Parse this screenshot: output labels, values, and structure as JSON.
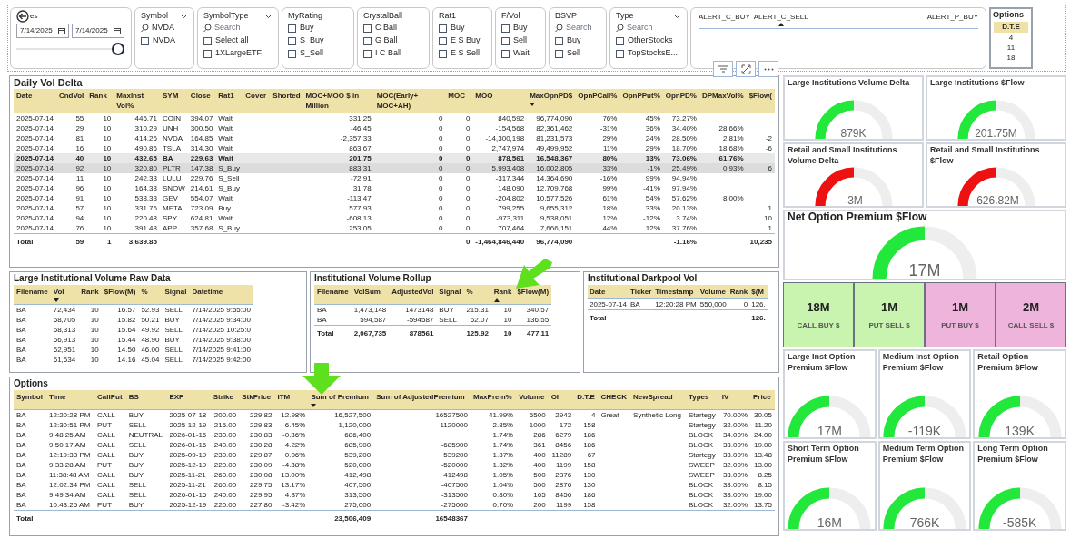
{
  "date_slicer": {
    "title": "es",
    "start": "7/14/2025",
    "end": "7/14/2025",
    "level": 1
  },
  "slicers": [
    {
      "title": "Symbol",
      "dropdown": true,
      "search_value": "NVDA",
      "items": [
        {
          "label": "NVDA",
          "checked": false
        }
      ]
    },
    {
      "title": "SymbolType",
      "dropdown": true,
      "search_placeholder": "Search",
      "items": [
        {
          "label": "Select all",
          "checked": false
        },
        {
          "label": "1XLargeETF",
          "checked": false
        }
      ]
    },
    {
      "title": "MyRating",
      "dropdown": false,
      "items": [
        {
          "label": "Buy",
          "checked": false
        },
        {
          "label": "S_Buy",
          "checked": false
        },
        {
          "label": "S_Sell",
          "checked": false
        }
      ]
    },
    {
      "title": "CrystalBall",
      "dropdown": false,
      "items": [
        {
          "label": "C Ball",
          "checked": false
        },
        {
          "label": "G Ball",
          "checked": false
        },
        {
          "label": "I C Ball",
          "checked": false
        }
      ]
    },
    {
      "title": "Rat1",
      "dropdown": false,
      "items": [
        {
          "label": "Buy",
          "checked": false
        },
        {
          "label": "E S Buy",
          "checked": false
        },
        {
          "label": "E S Sell",
          "checked": false
        }
      ]
    },
    {
      "title": "F/Vol",
      "dropdown": false,
      "items": [
        {
          "label": "Buy",
          "checked": false
        },
        {
          "label": "Sell",
          "checked": false
        },
        {
          "label": "Wait",
          "checked": false
        }
      ]
    },
    {
      "title": "BSVP",
      "dropdown": false,
      "search_placeholder": "Search",
      "items": [
        {
          "label": "Buy",
          "checked": false
        },
        {
          "label": "Sell",
          "checked": false
        }
      ]
    },
    {
      "title": "Type",
      "dropdown": true,
      "search_placeholder": "Search",
      "items": [
        {
          "label": "OtherStocks",
          "checked": false
        },
        {
          "label": "TopStocksE...",
          "checked": false
        }
      ]
    }
  ],
  "alerts": [
    {
      "label": "ALERT_C_BUY",
      "sorted": false
    },
    {
      "label": "ALERT_C_SELL",
      "sorted": true
    },
    {
      "label": "ALERT_P_BUY",
      "sorted": false
    }
  ],
  "options_slicer": {
    "title": "Options",
    "header": "D.T.E",
    "values": [
      "4",
      "11",
      "18"
    ]
  },
  "daily_vol_delta": {
    "title": "Daily Vol Delta",
    "sort_ascending": false,
    "columns": [
      {
        "label": "Date",
        "sorted": false
      },
      {
        "label": "CndVol",
        "sorted": false
      },
      {
        "label": "Rank",
        "sorted": false
      },
      {
        "label": "MaxInst Vol%",
        "sorted": false
      },
      {
        "label": "SYM",
        "sorted": false
      },
      {
        "label": "Close",
        "sorted": false
      },
      {
        "label": "Rat1",
        "sorted": false
      },
      {
        "label": "Cover",
        "sorted": false
      },
      {
        "label": "Shorted",
        "sorted": false
      },
      {
        "label": "MOC+MOO $ in Million",
        "sorted": false
      },
      {
        "label": "MOC(Early+ MOC+AH)",
        "sorted": false
      },
      {
        "label": "MOC",
        "sorted": false
      },
      {
        "label": "MOO",
        "sorted": false
      },
      {
        "label": "MaxOpnPD$",
        "sorted": true
      },
      {
        "label": "OpnPCall%",
        "sorted": false
      },
      {
        "label": "OpnPPut%",
        "sorted": false
      },
      {
        "label": "OpnPD%",
        "sorted": false
      },
      {
        "label": "DPMaxVol%",
        "sorted": false
      },
      {
        "label": "$Flow(",
        "sorted": false
      }
    ],
    "rows": [
      {
        "date": "2025-07-14",
        "cnd_vol": "55",
        "rank": "10",
        "max_inst": "446.71",
        "sym": "COIN",
        "close": "394.07",
        "rat1": "Wait",
        "moc_moo": "331.25",
        "moc_early": "0",
        "moc": "0",
        "moo": "840,592",
        "max_opn": "96,774,090",
        "call": "76%",
        "put": "45%",
        "opn_pd": "73.27%",
        "selected": false,
        "hovered": false
      },
      {
        "date": "2025-07-14",
        "cnd_vol": "29",
        "rank": "10",
        "max_inst": "310.29",
        "sym": "UNH",
        "close": "300.50",
        "rat1": "Wait",
        "moc_moo": "-46.45",
        "moc_early": "0",
        "moc": "0",
        "moo": "-154,568",
        "max_opn": "82,361,462",
        "call": "-31%",
        "put": "36%",
        "opn_pd": "34.40%",
        "dp_max": "28.66%",
        "selected": false,
        "hovered": false
      },
      {
        "date": "2025-07-14",
        "cnd_vol": "81",
        "rank": "10",
        "max_inst": "414.26",
        "sym": "NVDA",
        "close": "164.85",
        "rat1": "Wait",
        "moc_moo": "-2,357.33",
        "moc_early": "0",
        "moc": "0",
        "moo": "-14,300,198",
        "max_opn": "81,231,573",
        "call": "29%",
        "put": "24%",
        "opn_pd": "28.50%",
        "dp_max": "2.81%",
        "column_19": "-2",
        "selected": false,
        "hovered": false
      },
      {
        "date": "2025-07-14",
        "cnd_vol": "16",
        "rank": "10",
        "max_inst": "490.86",
        "sym": "TSLA",
        "close": "314.30",
        "rat1": "Wait",
        "moc_moo": "863.67",
        "moc_early": "0",
        "moc": "0",
        "moo": "2,747,974",
        "max_opn": "49,499,952",
        "call": "11%",
        "put": "29%",
        "opn_pd": "18.70%",
        "dp_max": "18.68%",
        "column_19": "-6",
        "selected": false,
        "hovered": false
      },
      {
        "date": "2025-07-14",
        "cnd_vol": "40",
        "rank": "10",
        "max_inst": "432.65",
        "sym": "BA",
        "close": "229.63",
        "rat1": "Wait",
        "moc_moo": "201.75",
        "moc_early": "0",
        "moc": "0",
        "moo": "878,561",
        "max_opn": "16,548,367",
        "call": "80%",
        "put": "13%",
        "opn_pd": "73.06%",
        "dp_max": "61.76%",
        "selected": true,
        "hovered": false
      },
      {
        "date": "2025-07-14",
        "cnd_vol": "92",
        "rank": "10",
        "max_inst": "320.80",
        "sym": "PLTR",
        "close": "147.38",
        "rat1": "S_Buy",
        "moc_moo": "883.31",
        "moc_early": "0",
        "moc": "0",
        "moo": "5,993,408",
        "max_opn": "16,002,805",
        "call": "33%",
        "put": "-1%",
        "opn_pd": "25.49%",
        "dp_max": "0.93%",
        "column_19": "6",
        "selected": false,
        "hovered": true
      },
      {
        "date": "2025-07-14",
        "cnd_vol": "11",
        "rank": "10",
        "max_inst": "242.33",
        "sym": "LULU",
        "close": "229.76",
        "rat1": "S_Sell",
        "moc_moo": "-72.91",
        "moc_early": "0",
        "moc": "0",
        "moo": "-317,344",
        "max_opn": "14,364,690",
        "call": "-16%",
        "put": "99%",
        "opn_pd": "94.94%",
        "selected": false,
        "hovered": false
      },
      {
        "date": "2025-07-14",
        "cnd_vol": "96",
        "rank": "10",
        "max_inst": "164.38",
        "sym": "SNOW",
        "close": "214.61",
        "rat1": "S_Buy",
        "moc_moo": "31.78",
        "moc_early": "0",
        "moc": "0",
        "moo": "148,090",
        "max_opn": "12,709,768",
        "call": "99%",
        "put": "-41%",
        "opn_pd": "97.94%",
        "selected": false,
        "hovered": false
      },
      {
        "date": "2025-07-14",
        "cnd_vol": "91",
        "rank": "10",
        "max_inst": "538.33",
        "sym": "GEV",
        "close": "554.07",
        "rat1": "Wait",
        "moc_moo": "-113.47",
        "moc_early": "0",
        "moc": "0",
        "moo": "-204,802",
        "max_opn": "10,577,526",
        "call": "61%",
        "put": "54%",
        "opn_pd": "57.62%",
        "dp_max": "8.00%",
        "selected": false,
        "hovered": false
      },
      {
        "date": "2025-07-14",
        "cnd_vol": "57",
        "rank": "10",
        "max_inst": "331.76",
        "sym": "META",
        "close": "723.09",
        "rat1": "Buy",
        "moc_moo": "577.93",
        "moc_early": "0",
        "moc": "0",
        "moo": "799,255",
        "max_opn": "9,655,312",
        "call": "18%",
        "put": "33%",
        "opn_pd": "20.13%",
        "column_19": "1",
        "selected": false,
        "hovered": false
      },
      {
        "date": "2025-07-14",
        "cnd_vol": "94",
        "rank": "10",
        "max_inst": "220.48",
        "sym": "SPY",
        "close": "624.81",
        "rat1": "Wait",
        "moc_moo": "-608.13",
        "moc_early": "0",
        "moc": "0",
        "moo": "-973,311",
        "max_opn": "9,538,051",
        "call": "12%",
        "put": "-12%",
        "opn_pd": "3.74%",
        "column_19": "10",
        "selected": false,
        "hovered": false
      },
      {
        "date": "2025-07-14",
        "cnd_vol": "76",
        "rank": "10",
        "max_inst": "391.48",
        "sym": "APP",
        "close": "357.68",
        "rat1": "S_Buy",
        "moc_moo": "253.05",
        "moc_early": "0",
        "moc": "0",
        "moo": "707,464",
        "max_opn": "7,666,151",
        "call": "44%",
        "put": "12%",
        "opn_pd": "37.76%",
        "column_19": "1",
        "selected": false,
        "hovered": false
      }
    ],
    "total": {
      "date": "Total",
      "cnd_vol": "59",
      "rank": "1",
      "max_inst": "3,639.85",
      "moc": "0",
      "moo": "-1,464,846,440",
      "max_opn": "96,774,090",
      "opn_pd": "-1.16%",
      "column_19": "10,235"
    }
  },
  "raw_data": {
    "title": "Large Institutional Volume Raw Data",
    "sort_ascending": false,
    "columns": [
      {
        "label": "Filename",
        "sorted": false
      },
      {
        "label": "Vol",
        "sorted": true
      },
      {
        "label": "Rank",
        "sorted": false
      },
      {
        "label": "$Flow(M)",
        "sorted": false
      },
      {
        "label": "%",
        "sorted": false
      },
      {
        "label": "Signal",
        "sorted": false
      },
      {
        "label": "Datetime",
        "sorted": false
      }
    ],
    "rows": [
      {
        "filename": "BA",
        "vol": "72,434",
        "rank": "10",
        "flow": "16.57",
        "pct": "52.93",
        "signal": "SELL",
        "datetime": "7/14/2025 9:55:00"
      },
      {
        "filename": "BA",
        "vol": "68,705",
        "rank": "10",
        "flow": "15.82",
        "pct": "50.21",
        "signal": "BUY",
        "datetime": "7/14/2025 9:34:00"
      },
      {
        "filename": "BA",
        "vol": "68,313",
        "rank": "10",
        "flow": "15.64",
        "pct": "49.92",
        "signal": "SELL",
        "datetime": "7/14/2025 10:25:0"
      },
      {
        "filename": "BA",
        "vol": "66,913",
        "rank": "10",
        "flow": "15.44",
        "pct": "48.90",
        "signal": "BUY",
        "datetime": "7/14/2025 9:38:00"
      },
      {
        "filename": "BA",
        "vol": "62,951",
        "rank": "10",
        "flow": "14.50",
        "pct": "46.00",
        "signal": "SELL",
        "datetime": "7/14/2025 9:41:00"
      },
      {
        "filename": "BA",
        "vol": "61,634",
        "rank": "10",
        "flow": "14.16",
        "pct": "45.04",
        "signal": "SELL",
        "datetime": "7/14/2025 9:42:00"
      }
    ]
  },
  "rollup": {
    "title": "Institutional Volume Rollup",
    "sort_ascending": true,
    "columns": [
      {
        "label": "Filename",
        "sorted": false
      },
      {
        "label": "VolSum",
        "sorted": false
      },
      {
        "label": "AdjustedVol",
        "sorted": false
      },
      {
        "label": "Signal",
        "sorted": false
      },
      {
        "label": "%",
        "sorted": false
      },
      {
        "label": "Rank",
        "sorted": true
      },
      {
        "label": "$Flow(M)",
        "sorted": false
      }
    ],
    "rows": [
      {
        "filename": "BA",
        "vol_sum": "1,473,148",
        "adjusted_vol": "1473148",
        "signal": "BUY",
        "pct": "215.31",
        "rank": "10",
        "flow": "340.57"
      },
      {
        "filename": "BA",
        "vol_sum": "594,587",
        "adjusted_vol": "-594587",
        "signal": "SELL",
        "pct": "62.07",
        "rank": "10",
        "flow": "136.55"
      }
    ],
    "total": {
      "filename": "Total",
      "vol_sum": "2,067,735",
      "adjusted_vol": "878561",
      "pct": "125.92",
      "rank": "10",
      "flow": "477.11"
    }
  },
  "darkpool": {
    "title": "Institutional Darkpool Vol",
    "columns": [
      {
        "label": "Date"
      },
      {
        "label": "Ticker"
      },
      {
        "label": "Timestamp"
      },
      {
        "label": "Volume"
      },
      {
        "label": "Rank"
      },
      {
        "label": "$(M"
      }
    ],
    "rows": [
      {
        "date": "2025-07-14",
        "ticker": "BA",
        "timestamp": "12:20:28 PM",
        "volume": "550,000",
        "rank": "0",
        "column_6": "126."
      }
    ],
    "total": {
      "date": "Total",
      "column_6": "126."
    }
  },
  "options": {
    "title": "Options",
    "sort_ascending": false,
    "columns": [
      {
        "label": "Symbol",
        "sorted": false
      },
      {
        "label": "Time",
        "sorted": false
      },
      {
        "label": "CallPut",
        "sorted": false
      },
      {
        "label": "BS",
        "sorted": false
      },
      {
        "label": "EXP",
        "sorted": false
      },
      {
        "label": "Strike",
        "sorted": false
      },
      {
        "label": "StkPrice",
        "sorted": false
      },
      {
        "label": "ITM",
        "sorted": false
      },
      {
        "label": "Sum of Premium",
        "sorted": true
      },
      {
        "label": "Sum of AdjustedPremium",
        "sorted": false
      },
      {
        "label": "MaxPrem%",
        "sorted": false
      },
      {
        "label": "Volume",
        "sorted": false
      },
      {
        "label": "OI",
        "sorted": false
      },
      {
        "label": "D.T.E",
        "sorted": false
      },
      {
        "label": "CHECK",
        "sorted": false
      },
      {
        "label": "NewSpread",
        "sorted": false
      },
      {
        "label": "Types",
        "sorted": false
      },
      {
        "label": "IV",
        "sorted": false
      },
      {
        "label": "Price",
        "sorted": false
      }
    ],
    "rows": [
      {
        "symbol": "BA",
        "time": "12:20:28 PM",
        "call_put": "CALL",
        "bs": "BUY",
        "exp": "2025-07-18",
        "strike": "200.00",
        "stk_price": "229.82",
        "itm": "-12.98%",
        "premium": "16,527,500",
        "adj_premium": "16527500",
        "max_prem": "41.99%",
        "volume": "5500",
        "oi": "2943",
        "dte": "4",
        "check": "Great",
        "new_spread": "Synthetic Long",
        "types": "Startegy",
        "iv": "70.00%",
        "price": "30.05"
      },
      {
        "symbol": "BA",
        "time": "12:30:51 PM",
        "call_put": "PUT",
        "bs": "SELL",
        "exp": "2025-12-19",
        "strike": "215.00",
        "stk_price": "229.83",
        "itm": "-6.45%",
        "premium": "1,120,000",
        "adj_premium": "1120000",
        "max_prem": "2.85%",
        "volume": "1000",
        "oi": "172",
        "dte": "158",
        "types": "Startegy",
        "iv": "32.00%",
        "price": "11.20"
      },
      {
        "symbol": "BA",
        "time": "9:48:25 AM",
        "call_put": "CALL",
        "bs": "NEUTRAL",
        "exp": "2026-01-16",
        "strike": "230.00",
        "stk_price": "230.83",
        "itm": "-0.36%",
        "premium": "686,400",
        "max_prem": "1.74%",
        "volume": "286",
        "oi": "6279",
        "dte": "186",
        "types": "BLOCK",
        "iv": "34.00%",
        "price": "24.00"
      },
      {
        "symbol": "BA",
        "time": "9:50:17 AM",
        "call_put": "CALL",
        "bs": "SELL",
        "exp": "2026-01-16",
        "strike": "240.00",
        "stk_price": "230.28",
        "itm": "4.22%",
        "premium": "685,900",
        "adj_premium": "-685900",
        "max_prem": "1.74%",
        "volume": "361",
        "oi": "8456",
        "dte": "186",
        "types": "BLOCK",
        "iv": "33.00%",
        "price": "19.00"
      },
      {
        "symbol": "BA",
        "time": "12:19:38 PM",
        "call_put": "CALL",
        "bs": "BUY",
        "exp": "2025-09-19",
        "strike": "230.00",
        "stk_price": "229.87",
        "itm": "0.06%",
        "premium": "539,200",
        "adj_premium": "539200",
        "max_prem": "1.37%",
        "volume": "400",
        "oi": "11289",
        "dte": "67",
        "types": "Startegy",
        "iv": "33.00%",
        "price": "13.48"
      },
      {
        "symbol": "BA",
        "time": "9:33:28 AM",
        "call_put": "PUT",
        "bs": "BUY",
        "exp": "2025-12-19",
        "strike": "220.00",
        "stk_price": "230.09",
        "itm": "-4.38%",
        "premium": "520,000",
        "adj_premium": "-520000",
        "max_prem": "1.32%",
        "volume": "400",
        "oi": "1199",
        "dte": "158",
        "types": "SWEEP",
        "iv": "32.00%",
        "price": "13.00"
      },
      {
        "symbol": "BA",
        "time": "11:38:48 AM",
        "call_put": "CALL",
        "bs": "BUY",
        "exp": "2025-11-21",
        "strike": "260.00",
        "stk_price": "230.08",
        "itm": "13.00%",
        "premium": "412,498",
        "adj_premium": "412498",
        "max_prem": "1.05%",
        "volume": "500",
        "oi": "2876",
        "dte": "130",
        "types": "SWEEP",
        "iv": "33.00%",
        "price": "8.25"
      },
      {
        "symbol": "BA",
        "time": "12:02:34 PM",
        "call_put": "CALL",
        "bs": "SELL",
        "exp": "2025-11-21",
        "strike": "260.00",
        "stk_price": "229.75",
        "itm": "13.17%",
        "premium": "407,500",
        "adj_premium": "-407500",
        "max_prem": "1.04%",
        "volume": "500",
        "oi": "2876",
        "dte": "130",
        "types": "BLOCK",
        "iv": "33.00%",
        "price": "8.15"
      },
      {
        "symbol": "BA",
        "time": "9:49:34 AM",
        "call_put": "CALL",
        "bs": "SELL",
        "exp": "2026-01-16",
        "strike": "240.00",
        "stk_price": "229.95",
        "itm": "4.37%",
        "premium": "313,500",
        "adj_premium": "-313500",
        "max_prem": "0.80%",
        "volume": "165",
        "oi": "8456",
        "dte": "186",
        "types": "BLOCK",
        "iv": "33.00%",
        "price": "19.00"
      },
      {
        "symbol": "BA",
        "time": "10:43:25 AM",
        "call_put": "PUT",
        "bs": "BUY",
        "exp": "2025-12-19",
        "strike": "220.00",
        "stk_price": "227.80",
        "itm": "-3.42%",
        "premium": "275,000",
        "adj_premium": "-275000",
        "max_prem": "0.70%",
        "volume": "200",
        "oi": "1199",
        "dte": "158",
        "types": "BLOCK",
        "iv": "32.00%",
        "price": "13.75"
      }
    ],
    "total": {
      "symbol": "Total",
      "premium": "23,506,409",
      "adj_premium": "16548367"
    }
  },
  "gauges": [
    {
      "title": "Large Institutions Volume Delta",
      "value": "879K",
      "level": 0.5,
      "color": "#22e83c"
    },
    {
      "title": "Large Institutions $Flow",
      "value": "201.75M",
      "level": 0.5,
      "color": "#22e83c"
    },
    {
      "title": "Retail and Small Institutions Volume Delta",
      "value": "-3M",
      "level": 0.5,
      "color": "#ee1111"
    },
    {
      "title": "Retail and Small Institutions $Flow",
      "value": "-626.82M",
      "level": 0.5,
      "color": "#ee1111"
    }
  ],
  "net_option": {
    "title": "Net Option Premium $Flow",
    "value": "17M",
    "level": 0.5,
    "color": "#22e83c"
  },
  "premium_boxes": [
    {
      "value": "18M",
      "label": "CALL BUY $",
      "color": "#c8f4b0"
    },
    {
      "value": "1M",
      "label": "PUT SELL $",
      "color": "#c8f4b0"
    },
    {
      "value": "1M",
      "label": "PUT BUY $",
      "color": "#eeb4dc"
    },
    {
      "value": "2M",
      "label": "CALL SELL $",
      "color": "#eeb4dc"
    }
  ],
  "option_gauges": [
    {
      "title": "Large Inst Option Premium $Flow",
      "value": "17M",
      "level": 0.5,
      "color": "#22e83c"
    },
    {
      "title": "Medium Inst Option Premium $Flow",
      "value": "-119K",
      "level": 0.5,
      "color": "#22e83c"
    },
    {
      "title": "Retail Option Premium $Flow",
      "value": "139K",
      "level": 0.5,
      "color": "#22e83c"
    },
    {
      "title": "Short Term Option Premium $Flow",
      "value": "16M",
      "level": 0.5,
      "color": "#22e83c"
    },
    {
      "title": "Medium Term Option Premium $Flow",
      "value": "766K",
      "level": 0.5,
      "color": "#22e83c"
    },
    {
      "title": "Long Term Option Premium $Flow",
      "value": "-585K",
      "level": 0.5,
      "color": "#22e83c"
    }
  ]
}
